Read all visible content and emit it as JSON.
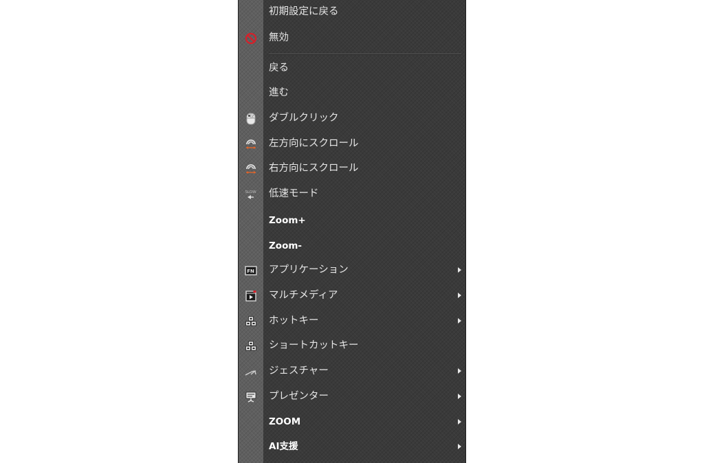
{
  "menu": {
    "items": [
      {
        "label": "初期設定に戻る"
      },
      {
        "label": "無効",
        "icon": "no-entry-icon"
      },
      {
        "label": "戻る"
      },
      {
        "label": "進む"
      },
      {
        "label": "ダブルクリック",
        "icon": "mouse-double-click-icon"
      },
      {
        "label": "左方向にスクロール",
        "icon": "scroll-left-icon"
      },
      {
        "label": "右方向にスクロール",
        "icon": "scroll-right-icon"
      },
      {
        "label": "低速モード",
        "icon": "slow-mode-icon",
        "icon_text": "SLOW"
      },
      {
        "label": "Zoom+"
      },
      {
        "label": "Zoom-"
      },
      {
        "label": "アプリケーション",
        "icon": "fn-key-icon",
        "icon_text": "FN",
        "submenu": true
      },
      {
        "label": "マルチメディア",
        "icon": "multimedia-icon",
        "submenu": true
      },
      {
        "label": "ホットキー",
        "icon": "hotkey-icon",
        "submenu": true
      },
      {
        "label": "ショートカットキー",
        "icon": "shortcut-key-icon"
      },
      {
        "label": "ジェスチャー",
        "icon": "gesture-icon",
        "submenu": true
      },
      {
        "label": "プレゼンター",
        "icon": "presenter-icon",
        "submenu": true
      },
      {
        "label": "ZOOM",
        "submenu": true
      },
      {
        "label": "AI支援",
        "submenu": true
      }
    ]
  },
  "colors": {
    "menu_background": "#3a3a3a",
    "gutter_background": "#5f5f5f",
    "text": "#e6e6e6",
    "no_entry_red": "#d6202a",
    "scroll_arrow_orange": "#e0652a"
  }
}
